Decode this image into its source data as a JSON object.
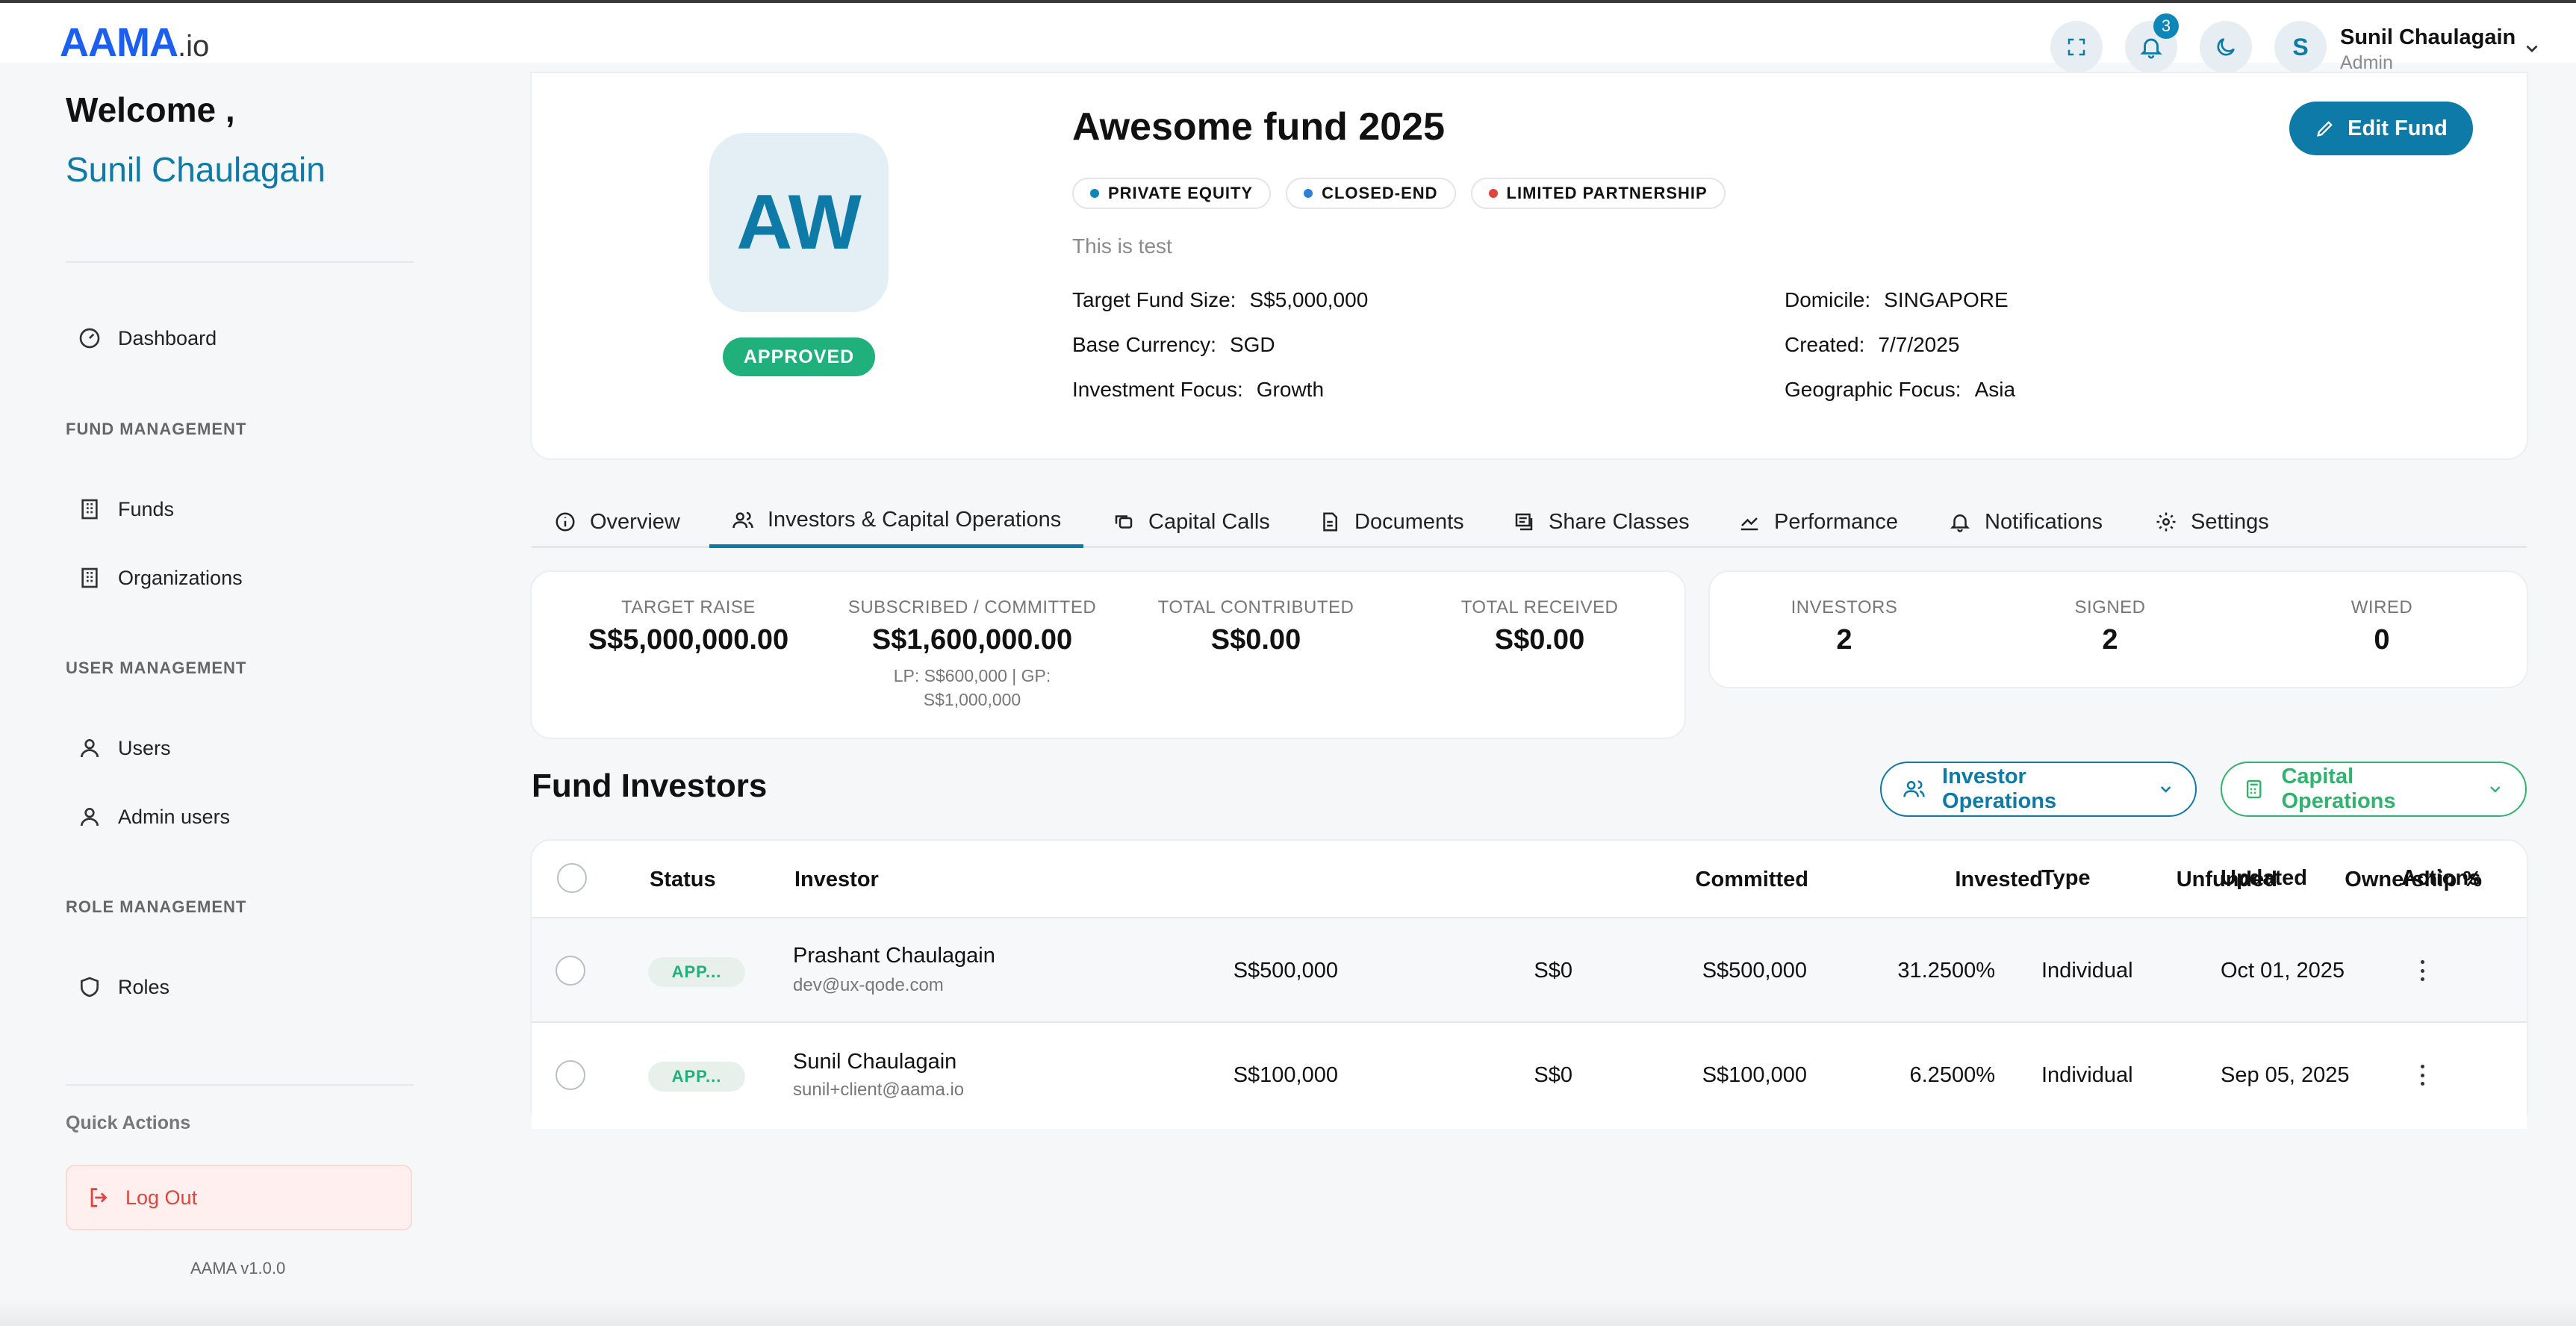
{
  "app": {
    "logo_main": "AAMA",
    "logo_suffix": ".io",
    "notifications_count": "3",
    "user_initial": "S",
    "user_name": "Sunil Chaulagain",
    "user_role": "Admin"
  },
  "sidebar": {
    "welcome": "Welcome ,",
    "welcome_name": "Sunil Chaulagain",
    "dashboard": "Dashboard",
    "sections": {
      "fund_management": "FUND MANAGEMENT",
      "user_management": "USER MANAGEMENT",
      "role_management": "ROLE MANAGEMENT"
    },
    "items": {
      "funds": "Funds",
      "organizations": "Organizations",
      "users": "Users",
      "admin_users": "Admin users",
      "roles": "Roles"
    },
    "quick_actions": "Quick Actions",
    "logout": "Log Out",
    "version": "AAMA v1.0.0"
  },
  "fund": {
    "initials": "AW",
    "status": "APPROVED",
    "title": "Awesome fund 2025",
    "tags": [
      {
        "label": "PRIVATE EQUITY",
        "color": "#0e86b8"
      },
      {
        "label": "CLOSED-END",
        "color": "#2f7fd6"
      },
      {
        "label": "LIMITED PARTNERSHIP",
        "color": "#e0443b"
      }
    ],
    "description": "This is test",
    "edit_label": "Edit Fund",
    "details": {
      "target_size_label": "Target Fund Size:",
      "target_size": "S$5,000,000",
      "base_currency_label": "Base Currency:",
      "base_currency": "SGD",
      "investment_focus_label": "Investment Focus:",
      "investment_focus": "Growth",
      "domicile_label": "Domicile:",
      "domicile": "SINGAPORE",
      "created_label": "Created:",
      "created": "7/7/2025",
      "geo_focus_label": "Geographic Focus:",
      "geo_focus": "Asia"
    }
  },
  "tabs": [
    {
      "label": "Overview",
      "icon": "info-icon"
    },
    {
      "label": "Investors & Capital Operations",
      "icon": "users-icon",
      "active": true
    },
    {
      "label": "Capital Calls",
      "icon": "copy-icon"
    },
    {
      "label": "Documents",
      "icon": "document-icon"
    },
    {
      "label": "Share Classes",
      "icon": "receipt-icon"
    },
    {
      "label": "Performance",
      "icon": "chart-icon"
    },
    {
      "label": "Notifications",
      "icon": "bell-icon"
    },
    {
      "label": "Settings",
      "icon": "gear-icon"
    }
  ],
  "stats": {
    "target_raise_label": "TARGET RAISE",
    "target_raise": "S$5,000,000.00",
    "subscribed_label": "SUBSCRIBED / COMMITTED",
    "subscribed": "S$1,600,000.00",
    "subscribed_sub1": "LP: S$600,000 | GP:",
    "subscribed_sub2": "S$1,000,000",
    "contributed_label": "TOTAL CONTRIBUTED",
    "contributed": "S$0.00",
    "received_label": "TOTAL RECEIVED",
    "received": "S$0.00",
    "investors_label": "INVESTORS",
    "investors": "2",
    "signed_label": "SIGNED",
    "signed": "2",
    "wired_label": "WIRED",
    "wired": "0"
  },
  "investors_section": {
    "title": "Fund Investors",
    "investor_ops": "Investor Operations",
    "capital_ops": "Capital Operations"
  },
  "table": {
    "columns": [
      "Status",
      "Investor",
      "Committed",
      "Invested",
      "Unfunded",
      "Ownership %",
      "Type",
      "Updated",
      "Actions"
    ],
    "rows": [
      {
        "status": "APP...",
        "name": "Prashant Chaulagain",
        "email": "dev@ux-qode.com",
        "committed": "S$500,000",
        "invested": "S$0",
        "unfunded": "S$500,000",
        "ownership": "31.2500%",
        "type": "Individual",
        "updated": "Oct 01, 2025"
      },
      {
        "status": "APP...",
        "name": "Sunil Chaulagain",
        "email": "sunil+client@aama.io",
        "committed": "S$100,000",
        "invested": "S$0",
        "unfunded": "S$100,000",
        "ownership": "6.2500%",
        "type": "Individual",
        "updated": "Sep 05, 2025"
      }
    ]
  }
}
